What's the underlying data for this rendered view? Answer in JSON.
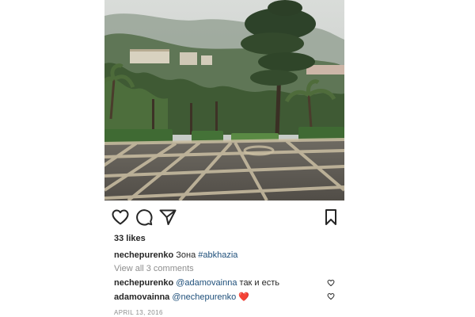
{
  "post": {
    "image": {
      "description": "Rainy park square with palm trees, tall pine and a sanatorium on a misty hillside"
    },
    "actions": {
      "like_icon": "heart-outline-icon",
      "comment_icon": "speech-bubble-icon",
      "share_icon": "paper-plane-icon",
      "save_icon": "bookmark-icon"
    },
    "likes": "33 likes",
    "caption": {
      "username": "nechepurenko",
      "text": " Зона ",
      "hashtag": "#abkhazia"
    },
    "view_all_comments": "View all 3 comments",
    "comments": [
      {
        "username": "nechepurenko",
        "mention": "@adamovainna",
        "text": " так и есть",
        "emoji": ""
      },
      {
        "username": "adamovainna",
        "mention": "@nechepurenko",
        "text": " ",
        "emoji": "❤️"
      }
    ],
    "date": "APRIL 13, 2016"
  }
}
